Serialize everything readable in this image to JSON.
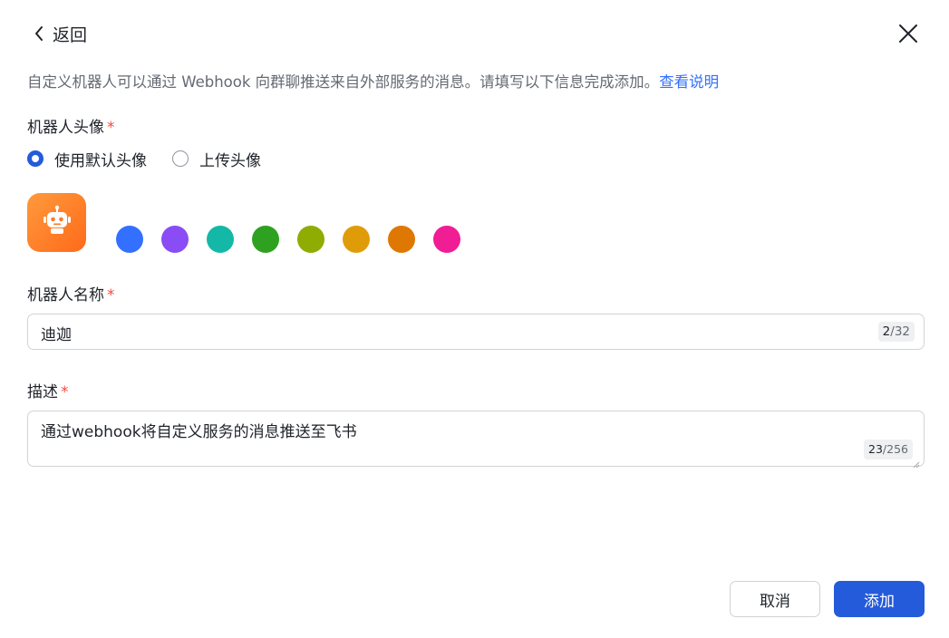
{
  "header": {
    "back_label": "返回",
    "back_icon": "chevron-left-icon",
    "close_icon": "close-icon"
  },
  "intro": {
    "text": "自定义机器人可以通过 Webhook 向群聊推送来自外部服务的消息。请填写以下信息完成添加。",
    "link_text": "查看说明",
    "link_color": "#3370ff"
  },
  "avatar_section": {
    "label": "机器人头像",
    "required_mark": "*",
    "options": [
      {
        "label": "使用默认头像",
        "checked": true
      },
      {
        "label": "上传头像",
        "checked": false
      }
    ],
    "avatar_icon": "robot-icon",
    "avatar_color": "#ff7a26",
    "swatches": [
      "#3370ff",
      "#8a4cf5",
      "#14b8a6",
      "#2ea121",
      "#8fac02",
      "#e09c08",
      "#de7802",
      "#f01d94"
    ]
  },
  "name_field": {
    "label": "机器人名称",
    "required_mark": "*",
    "value": "迪迦",
    "count_current": "2",
    "count_max": "/32"
  },
  "description_field": {
    "label": "描述",
    "required_mark": "*",
    "value": "通过webhook将自定义服务的消息推送至飞书",
    "count_current": "23",
    "count_max": "/256"
  },
  "footer": {
    "cancel_label": "取消",
    "add_label": "添加",
    "primary_color": "#245bdb"
  }
}
